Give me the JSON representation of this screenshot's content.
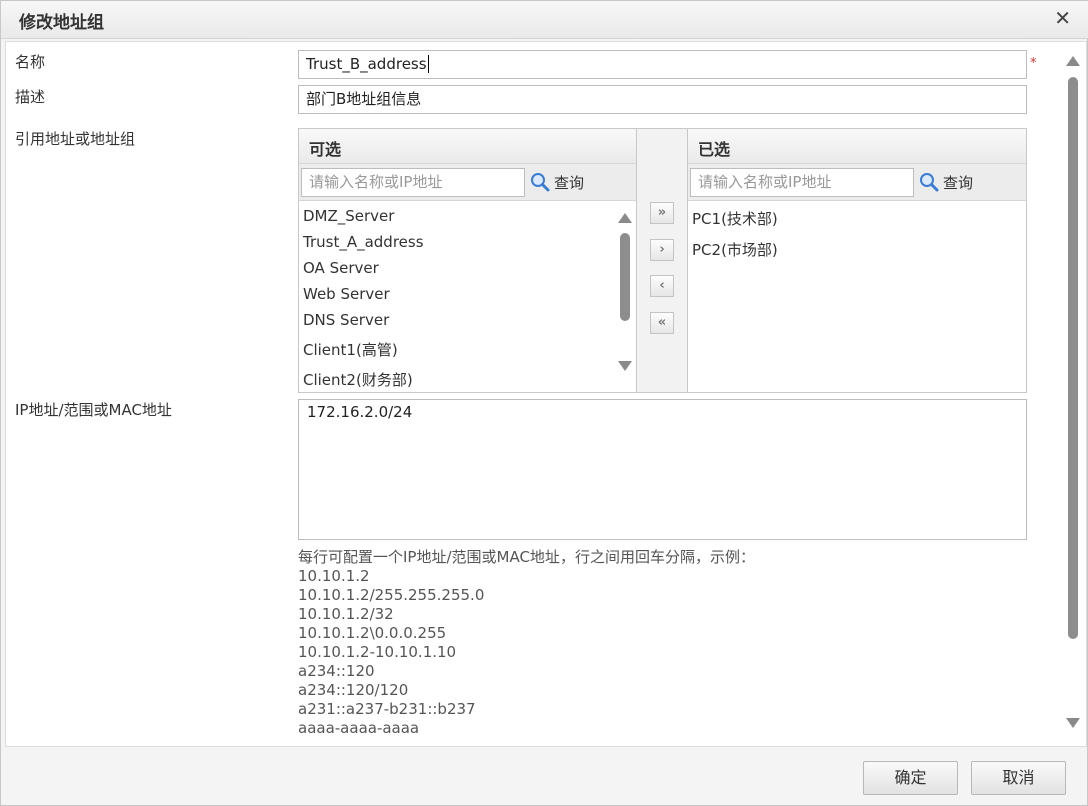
{
  "dialog": {
    "title": "修改地址组",
    "close_label": "✕"
  },
  "form": {
    "name_label": "名称",
    "name_value": "Trust_B_address",
    "required_mark": "*",
    "desc_label": "描述",
    "desc_value": "部门B地址组信息",
    "ref_label": "引用地址或地址组",
    "ip_label": "IP地址/范围或MAC地址",
    "ip_value": "172.16.2.0/24"
  },
  "available": {
    "header": "可选",
    "search_placeholder": "请输入名称或IP地址",
    "search_button": "查询",
    "items": [
      "DMZ_Server",
      "Trust_A_address",
      "OA Server",
      "Web Server",
      "DNS Server",
      "Client1(高管)",
      "Client2(财务部)"
    ]
  },
  "selected": {
    "header": "已选",
    "search_placeholder": "请输入名称或IP地址",
    "search_button": "查询",
    "items": [
      "PC1(技术部)",
      "PC2(市场部)"
    ]
  },
  "move_buttons": {
    "add_all": "»",
    "add": "›",
    "remove": "‹",
    "remove_all": "«"
  },
  "hint": {
    "intro": "每行可配置一个IP地址/范围或MAC地址，行之间用回车分隔，示例：",
    "examples": [
      "10.10.1.2",
      "10.10.1.2/255.255.255.0",
      "10.10.1.2/32",
      "10.10.1.2\\0.0.0.255",
      "10.10.1.2-10.10.1.10",
      "a234::120",
      "a234::120/120",
      "a231::a237-b231::b237",
      "aaaa-aaaa-aaaa"
    ]
  },
  "footer": {
    "ok_label": "确定",
    "cancel_label": "取消"
  },
  "colors": {
    "accent_search_icon": "#3a7bd5",
    "required": "#e03030"
  }
}
